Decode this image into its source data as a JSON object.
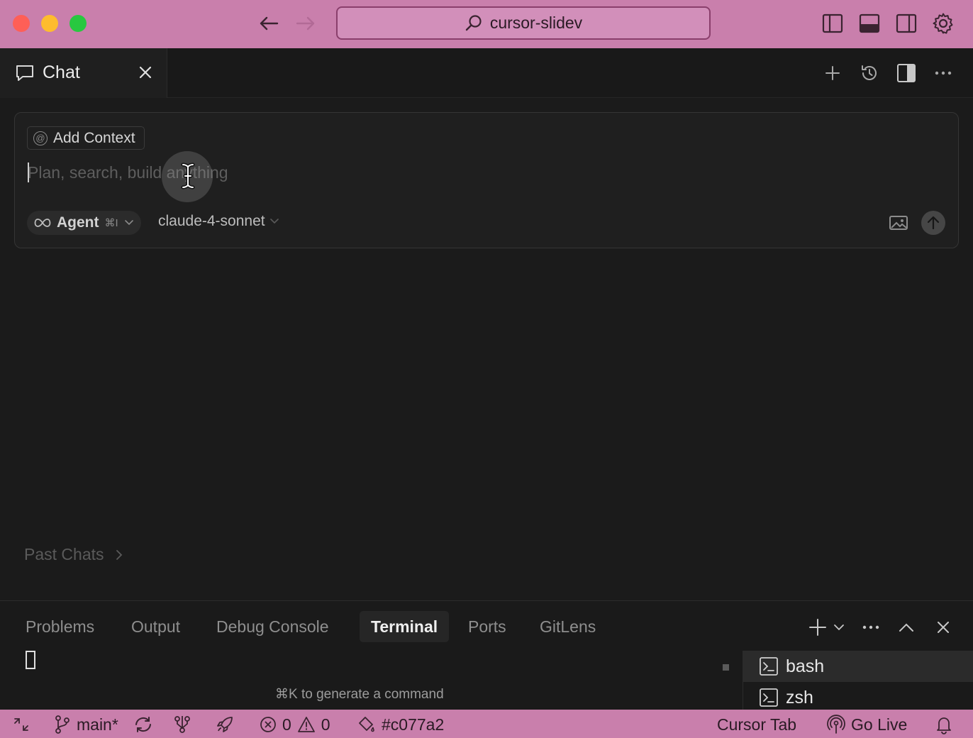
{
  "window": {
    "search_text": "cursor-slidev"
  },
  "chat": {
    "tab_label": "Chat",
    "add_context_label": "Add Context",
    "input_placeholder": "Plan, search, build anything",
    "agent_label": "Agent",
    "agent_shortcut": "⌘I",
    "model_label": "claude-4-sonnet",
    "past_chats_label": "Past Chats"
  },
  "panel": {
    "tabs": [
      {
        "label": "Problems"
      },
      {
        "label": "Output"
      },
      {
        "label": "Debug Console"
      },
      {
        "label": "Terminal",
        "active": true
      },
      {
        "label": "Ports"
      },
      {
        "label": "GitLens"
      }
    ],
    "terminal_hint": "⌘K to generate a command",
    "terminals": [
      {
        "label": "bash",
        "selected": true
      },
      {
        "label": "zsh"
      }
    ]
  },
  "statusbar": {
    "branch": "main*",
    "errors": "0",
    "warnings": "0",
    "commit": "#c077a2",
    "cursor_tab": "Cursor Tab",
    "go_live": "Go Live"
  },
  "colors": {
    "accent_bar": "#c97fac",
    "editor_bg": "#1b1b1b"
  }
}
